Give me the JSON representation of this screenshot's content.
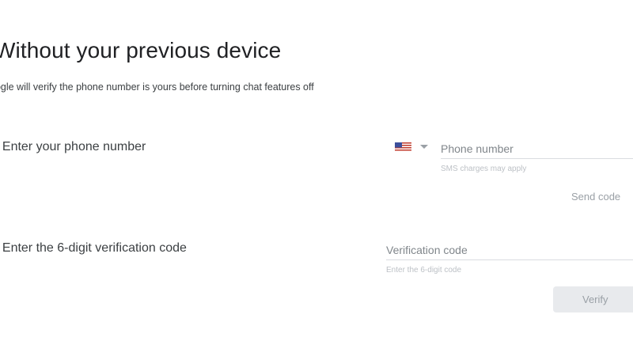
{
  "header": {
    "title": "Without your previous device",
    "subtitle": "oogle will verify the phone number is yours before turning chat features off"
  },
  "step1": {
    "label": ". Enter your phone number",
    "country_flag_icon": "us-flag-icon",
    "phone_placeholder": "Phone number",
    "phone_value": "",
    "helper": "SMS charges may apply",
    "send_code_label": "Send code"
  },
  "step2": {
    "label": ". Enter the 6-digit verification code",
    "code_placeholder": "Verification code",
    "code_value": "",
    "helper": "Enter the 6-digit code",
    "verify_label": "Verify"
  },
  "colors": {
    "text_primary": "#202124",
    "text_secondary": "#3c4043",
    "disabled": "#9aa0a6",
    "button_disabled_bg": "#e8eaed",
    "divider": "#dadce0"
  }
}
